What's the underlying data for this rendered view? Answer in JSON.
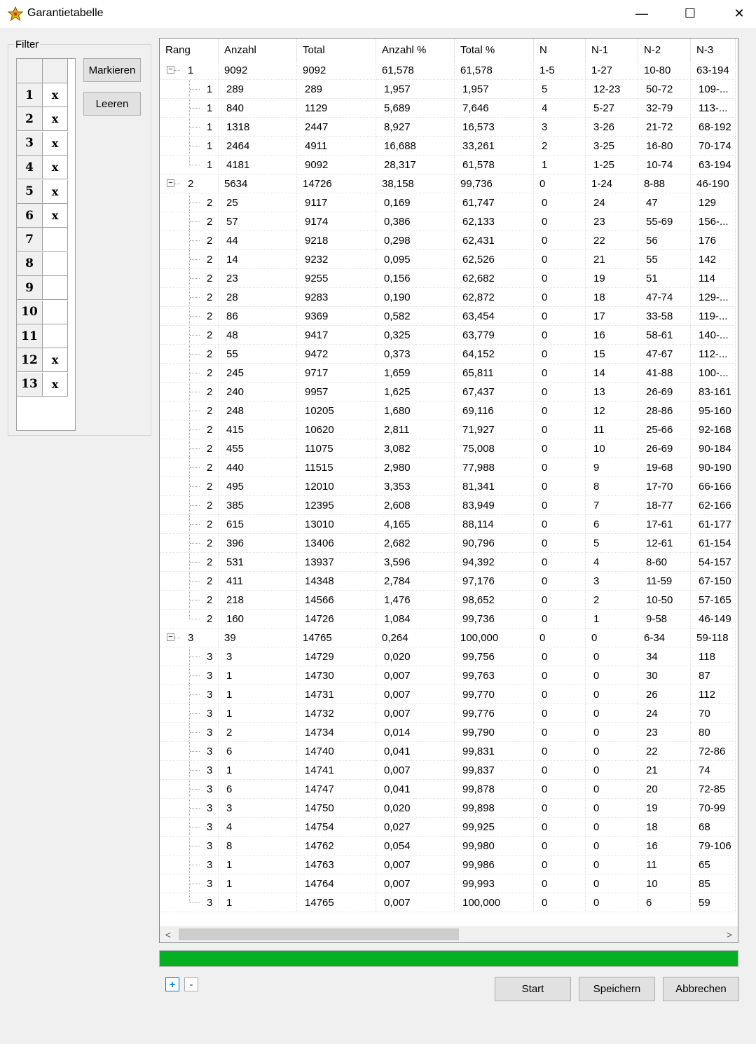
{
  "window": {
    "title": "Garantietabelle",
    "icon": "star-app-icon",
    "controls": {
      "minimize": "—",
      "maximize": "☐",
      "close": "✕"
    }
  },
  "filter": {
    "label": "Filter",
    "rows": [
      {
        "num": "1",
        "mark": "x"
      },
      {
        "num": "2",
        "mark": "x"
      },
      {
        "num": "3",
        "mark": "x"
      },
      {
        "num": "4",
        "mark": "x"
      },
      {
        "num": "5",
        "mark": "x"
      },
      {
        "num": "6",
        "mark": "x"
      },
      {
        "num": "7",
        "mark": ""
      },
      {
        "num": "8",
        "mark": ""
      },
      {
        "num": "9",
        "mark": ""
      },
      {
        "num": "10",
        "mark": ""
      },
      {
        "num": "11",
        "mark": ""
      },
      {
        "num": "12",
        "mark": "x"
      },
      {
        "num": "13",
        "mark": "x"
      }
    ],
    "mark_button": "Markieren",
    "clear_button": "Leeren"
  },
  "table": {
    "columns": [
      "Rang",
      "Anzahl",
      "Total",
      "Anzahl %",
      "Total %",
      "N",
      "N-1",
      "N-2",
      "N-3"
    ],
    "rows": [
      {
        "level": 0,
        "exp": true,
        "c": [
          "1",
          "9092",
          "9092",
          "61,578",
          "61,578",
          "1-5",
          "1-27",
          "10-80",
          "63-194"
        ]
      },
      {
        "level": 1,
        "c": [
          "1",
          "289",
          "289",
          "1,957",
          "1,957",
          "5",
          "12-23",
          "50-72",
          "109-..."
        ]
      },
      {
        "level": 1,
        "c": [
          "1",
          "840",
          "1129",
          "5,689",
          "7,646",
          "4",
          "5-27",
          "32-79",
          "113-..."
        ]
      },
      {
        "level": 1,
        "c": [
          "1",
          "1318",
          "2447",
          "8,927",
          "16,573",
          "3",
          "3-26",
          "21-72",
          "68-192"
        ]
      },
      {
        "level": 1,
        "c": [
          "1",
          "2464",
          "4911",
          "16,688",
          "33,261",
          "2",
          "3-25",
          "16-80",
          "70-174"
        ]
      },
      {
        "level": 1,
        "last": true,
        "c": [
          "1",
          "4181",
          "9092",
          "28,317",
          "61,578",
          "1",
          "1-25",
          "10-74",
          "63-194"
        ]
      },
      {
        "level": 0,
        "exp": true,
        "c": [
          "2",
          "5634",
          "14726",
          "38,158",
          "99,736",
          "0",
          "1-24",
          "8-88",
          "46-190"
        ]
      },
      {
        "level": 1,
        "c": [
          "2",
          "25",
          "9117",
          "0,169",
          "61,747",
          "0",
          "24",
          "47",
          "129"
        ]
      },
      {
        "level": 1,
        "c": [
          "2",
          "57",
          "9174",
          "0,386",
          "62,133",
          "0",
          "23",
          "55-69",
          "156-..."
        ]
      },
      {
        "level": 1,
        "c": [
          "2",
          "44",
          "9218",
          "0,298",
          "62,431",
          "0",
          "22",
          "56",
          "176"
        ]
      },
      {
        "level": 1,
        "c": [
          "2",
          "14",
          "9232",
          "0,095",
          "62,526",
          "0",
          "21",
          "55",
          "142"
        ]
      },
      {
        "level": 1,
        "c": [
          "2",
          "23",
          "9255",
          "0,156",
          "62,682",
          "0",
          "19",
          "51",
          "114"
        ]
      },
      {
        "level": 1,
        "c": [
          "2",
          "28",
          "9283",
          "0,190",
          "62,872",
          "0",
          "18",
          "47-74",
          "129-..."
        ]
      },
      {
        "level": 1,
        "c": [
          "2",
          "86",
          "9369",
          "0,582",
          "63,454",
          "0",
          "17",
          "33-58",
          "119-..."
        ]
      },
      {
        "level": 1,
        "c": [
          "2",
          "48",
          "9417",
          "0,325",
          "63,779",
          "0",
          "16",
          "58-61",
          "140-..."
        ]
      },
      {
        "level": 1,
        "c": [
          "2",
          "55",
          "9472",
          "0,373",
          "64,152",
          "0",
          "15",
          "47-67",
          "112-..."
        ]
      },
      {
        "level": 1,
        "c": [
          "2",
          "245",
          "9717",
          "1,659",
          "65,811",
          "0",
          "14",
          "41-88",
          "100-..."
        ]
      },
      {
        "level": 1,
        "c": [
          "2",
          "240",
          "9957",
          "1,625",
          "67,437",
          "0",
          "13",
          "26-69",
          "83-161"
        ]
      },
      {
        "level": 1,
        "c": [
          "2",
          "248",
          "10205",
          "1,680",
          "69,116",
          "0",
          "12",
          "28-86",
          "95-160"
        ]
      },
      {
        "level": 1,
        "c": [
          "2",
          "415",
          "10620",
          "2,811",
          "71,927",
          "0",
          "11",
          "25-66",
          "92-168"
        ]
      },
      {
        "level": 1,
        "c": [
          "2",
          "455",
          "11075",
          "3,082",
          "75,008",
          "0",
          "10",
          "26-69",
          "90-184"
        ]
      },
      {
        "level": 1,
        "c": [
          "2",
          "440",
          "11515",
          "2,980",
          "77,988",
          "0",
          "9",
          "19-68",
          "90-190"
        ]
      },
      {
        "level": 1,
        "c": [
          "2",
          "495",
          "12010",
          "3,353",
          "81,341",
          "0",
          "8",
          "17-70",
          "66-166"
        ]
      },
      {
        "level": 1,
        "c": [
          "2",
          "385",
          "12395",
          "2,608",
          "83,949",
          "0",
          "7",
          "18-77",
          "62-166"
        ]
      },
      {
        "level": 1,
        "c": [
          "2",
          "615",
          "13010",
          "4,165",
          "88,114",
          "0",
          "6",
          "17-61",
          "61-177"
        ]
      },
      {
        "level": 1,
        "c": [
          "2",
          "396",
          "13406",
          "2,682",
          "90,796",
          "0",
          "5",
          "12-61",
          "61-154"
        ]
      },
      {
        "level": 1,
        "c": [
          "2",
          "531",
          "13937",
          "3,596",
          "94,392",
          "0",
          "4",
          "8-60",
          "54-157"
        ]
      },
      {
        "level": 1,
        "c": [
          "2",
          "411",
          "14348",
          "2,784",
          "97,176",
          "0",
          "3",
          "11-59",
          "67-150"
        ]
      },
      {
        "level": 1,
        "c": [
          "2",
          "218",
          "14566",
          "1,476",
          "98,652",
          "0",
          "2",
          "10-50",
          "57-165"
        ]
      },
      {
        "level": 1,
        "last": true,
        "c": [
          "2",
          "160",
          "14726",
          "1,084",
          "99,736",
          "0",
          "1",
          "9-58",
          "46-149"
        ]
      },
      {
        "level": 0,
        "exp": true,
        "c": [
          "3",
          "39",
          "14765",
          "0,264",
          "100,000",
          "0",
          "0",
          "6-34",
          "59-118"
        ]
      },
      {
        "level": 1,
        "c": [
          "3",
          "3",
          "14729",
          "0,020",
          "99,756",
          "0",
          "0",
          "34",
          "118"
        ]
      },
      {
        "level": 1,
        "c": [
          "3",
          "1",
          "14730",
          "0,007",
          "99,763",
          "0",
          "0",
          "30",
          "87"
        ]
      },
      {
        "level": 1,
        "c": [
          "3",
          "1",
          "14731",
          "0,007",
          "99,770",
          "0",
          "0",
          "26",
          "112"
        ]
      },
      {
        "level": 1,
        "c": [
          "3",
          "1",
          "14732",
          "0,007",
          "99,776",
          "0",
          "0",
          "24",
          "70"
        ]
      },
      {
        "level": 1,
        "c": [
          "3",
          "2",
          "14734",
          "0,014",
          "99,790",
          "0",
          "0",
          "23",
          "80"
        ]
      },
      {
        "level": 1,
        "c": [
          "3",
          "6",
          "14740",
          "0,041",
          "99,831",
          "0",
          "0",
          "22",
          "72-86"
        ]
      },
      {
        "level": 1,
        "c": [
          "3",
          "1",
          "14741",
          "0,007",
          "99,837",
          "0",
          "0",
          "21",
          "74"
        ]
      },
      {
        "level": 1,
        "c": [
          "3",
          "6",
          "14747",
          "0,041",
          "99,878",
          "0",
          "0",
          "20",
          "72-85"
        ]
      },
      {
        "level": 1,
        "c": [
          "3",
          "3",
          "14750",
          "0,020",
          "99,898",
          "0",
          "0",
          "19",
          "70-99"
        ]
      },
      {
        "level": 1,
        "c": [
          "3",
          "4",
          "14754",
          "0,027",
          "99,925",
          "0",
          "0",
          "18",
          "68"
        ]
      },
      {
        "level": 1,
        "c": [
          "3",
          "8",
          "14762",
          "0,054",
          "99,980",
          "0",
          "0",
          "16",
          "79-106"
        ]
      },
      {
        "level": 1,
        "c": [
          "3",
          "1",
          "14763",
          "0,007",
          "99,986",
          "0",
          "0",
          "11",
          "65"
        ]
      },
      {
        "level": 1,
        "c": [
          "3",
          "1",
          "14764",
          "0,007",
          "99,993",
          "0",
          "0",
          "10",
          "85"
        ]
      },
      {
        "level": 1,
        "last": true,
        "c": [
          "3",
          "1",
          "14765",
          "0,007",
          "100,000",
          "0",
          "0",
          "6",
          "59"
        ]
      }
    ]
  },
  "scrollbar": {
    "left_arrow": "<",
    "right_arrow": ">"
  },
  "progress": {
    "fraction": 1.0,
    "color": "#06b025"
  },
  "expand_all": "+",
  "collapse_all": "-",
  "buttons": {
    "start": "Start",
    "save": "Speichern",
    "cancel": "Abbrechen"
  }
}
